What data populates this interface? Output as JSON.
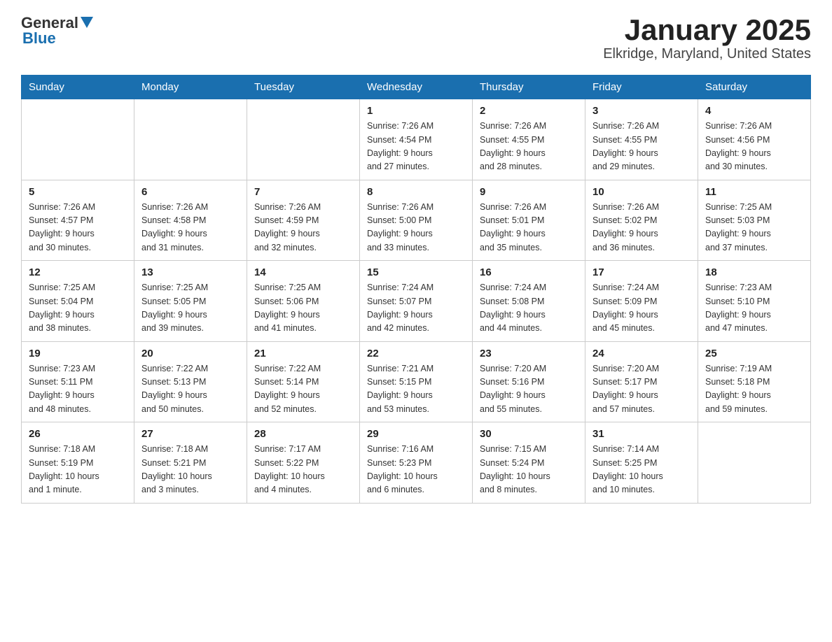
{
  "header": {
    "logo": {
      "general": "General",
      "blue": "Blue"
    },
    "title": "January 2025",
    "subtitle": "Elkridge, Maryland, United States"
  },
  "days_of_week": [
    "Sunday",
    "Monday",
    "Tuesday",
    "Wednesday",
    "Thursday",
    "Friday",
    "Saturday"
  ],
  "weeks": [
    [
      {
        "day": "",
        "info": ""
      },
      {
        "day": "",
        "info": ""
      },
      {
        "day": "",
        "info": ""
      },
      {
        "day": "1",
        "info": "Sunrise: 7:26 AM\nSunset: 4:54 PM\nDaylight: 9 hours\nand 27 minutes."
      },
      {
        "day": "2",
        "info": "Sunrise: 7:26 AM\nSunset: 4:55 PM\nDaylight: 9 hours\nand 28 minutes."
      },
      {
        "day": "3",
        "info": "Sunrise: 7:26 AM\nSunset: 4:55 PM\nDaylight: 9 hours\nand 29 minutes."
      },
      {
        "day": "4",
        "info": "Sunrise: 7:26 AM\nSunset: 4:56 PM\nDaylight: 9 hours\nand 30 minutes."
      }
    ],
    [
      {
        "day": "5",
        "info": "Sunrise: 7:26 AM\nSunset: 4:57 PM\nDaylight: 9 hours\nand 30 minutes."
      },
      {
        "day": "6",
        "info": "Sunrise: 7:26 AM\nSunset: 4:58 PM\nDaylight: 9 hours\nand 31 minutes."
      },
      {
        "day": "7",
        "info": "Sunrise: 7:26 AM\nSunset: 4:59 PM\nDaylight: 9 hours\nand 32 minutes."
      },
      {
        "day": "8",
        "info": "Sunrise: 7:26 AM\nSunset: 5:00 PM\nDaylight: 9 hours\nand 33 minutes."
      },
      {
        "day": "9",
        "info": "Sunrise: 7:26 AM\nSunset: 5:01 PM\nDaylight: 9 hours\nand 35 minutes."
      },
      {
        "day": "10",
        "info": "Sunrise: 7:26 AM\nSunset: 5:02 PM\nDaylight: 9 hours\nand 36 minutes."
      },
      {
        "day": "11",
        "info": "Sunrise: 7:25 AM\nSunset: 5:03 PM\nDaylight: 9 hours\nand 37 minutes."
      }
    ],
    [
      {
        "day": "12",
        "info": "Sunrise: 7:25 AM\nSunset: 5:04 PM\nDaylight: 9 hours\nand 38 minutes."
      },
      {
        "day": "13",
        "info": "Sunrise: 7:25 AM\nSunset: 5:05 PM\nDaylight: 9 hours\nand 39 minutes."
      },
      {
        "day": "14",
        "info": "Sunrise: 7:25 AM\nSunset: 5:06 PM\nDaylight: 9 hours\nand 41 minutes."
      },
      {
        "day": "15",
        "info": "Sunrise: 7:24 AM\nSunset: 5:07 PM\nDaylight: 9 hours\nand 42 minutes."
      },
      {
        "day": "16",
        "info": "Sunrise: 7:24 AM\nSunset: 5:08 PM\nDaylight: 9 hours\nand 44 minutes."
      },
      {
        "day": "17",
        "info": "Sunrise: 7:24 AM\nSunset: 5:09 PM\nDaylight: 9 hours\nand 45 minutes."
      },
      {
        "day": "18",
        "info": "Sunrise: 7:23 AM\nSunset: 5:10 PM\nDaylight: 9 hours\nand 47 minutes."
      }
    ],
    [
      {
        "day": "19",
        "info": "Sunrise: 7:23 AM\nSunset: 5:11 PM\nDaylight: 9 hours\nand 48 minutes."
      },
      {
        "day": "20",
        "info": "Sunrise: 7:22 AM\nSunset: 5:13 PM\nDaylight: 9 hours\nand 50 minutes."
      },
      {
        "day": "21",
        "info": "Sunrise: 7:22 AM\nSunset: 5:14 PM\nDaylight: 9 hours\nand 52 minutes."
      },
      {
        "day": "22",
        "info": "Sunrise: 7:21 AM\nSunset: 5:15 PM\nDaylight: 9 hours\nand 53 minutes."
      },
      {
        "day": "23",
        "info": "Sunrise: 7:20 AM\nSunset: 5:16 PM\nDaylight: 9 hours\nand 55 minutes."
      },
      {
        "day": "24",
        "info": "Sunrise: 7:20 AM\nSunset: 5:17 PM\nDaylight: 9 hours\nand 57 minutes."
      },
      {
        "day": "25",
        "info": "Sunrise: 7:19 AM\nSunset: 5:18 PM\nDaylight: 9 hours\nand 59 minutes."
      }
    ],
    [
      {
        "day": "26",
        "info": "Sunrise: 7:18 AM\nSunset: 5:19 PM\nDaylight: 10 hours\nand 1 minute."
      },
      {
        "day": "27",
        "info": "Sunrise: 7:18 AM\nSunset: 5:21 PM\nDaylight: 10 hours\nand 3 minutes."
      },
      {
        "day": "28",
        "info": "Sunrise: 7:17 AM\nSunset: 5:22 PM\nDaylight: 10 hours\nand 4 minutes."
      },
      {
        "day": "29",
        "info": "Sunrise: 7:16 AM\nSunset: 5:23 PM\nDaylight: 10 hours\nand 6 minutes."
      },
      {
        "day": "30",
        "info": "Sunrise: 7:15 AM\nSunset: 5:24 PM\nDaylight: 10 hours\nand 8 minutes."
      },
      {
        "day": "31",
        "info": "Sunrise: 7:14 AM\nSunset: 5:25 PM\nDaylight: 10 hours\nand 10 minutes."
      },
      {
        "day": "",
        "info": ""
      }
    ]
  ]
}
